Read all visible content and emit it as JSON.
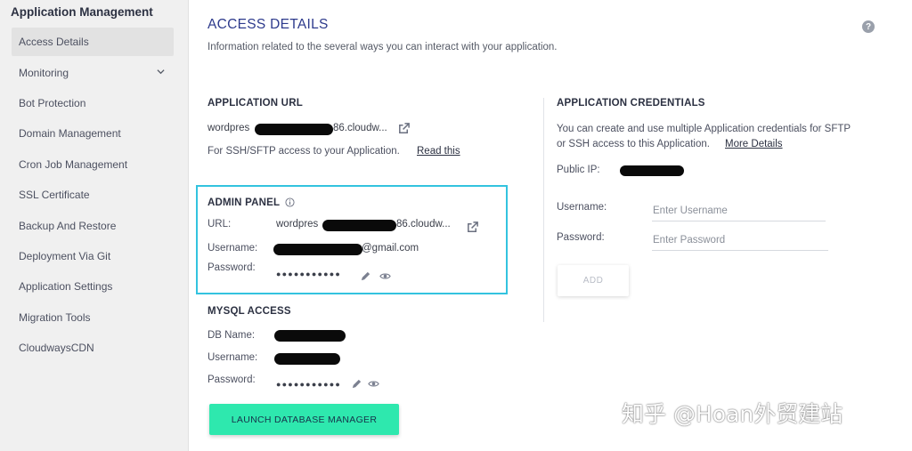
{
  "sidebar": {
    "title": "Application Management",
    "items": [
      {
        "label": "Access Details"
      },
      {
        "label": "Monitoring"
      },
      {
        "label": "Bot Protection"
      },
      {
        "label": "Domain Management"
      },
      {
        "label": "Cron Job Management"
      },
      {
        "label": "SSL Certificate"
      },
      {
        "label": "Backup And Restore"
      },
      {
        "label": "Deployment Via Git"
      },
      {
        "label": "Application Settings"
      },
      {
        "label": "Migration Tools"
      },
      {
        "label": "CloudwaysCDN"
      }
    ]
  },
  "header": {
    "title": "ACCESS DETAILS",
    "description": "Information related to the several ways you can interact with your application.",
    "help_icon": "?"
  },
  "app_url": {
    "title": "APPLICATION URL",
    "url_prefix": "wordpres",
    "url_suffix": "86.cloudw...",
    "ssh_note": "For SSH/SFTP access to your Application.",
    "read_link": "Read this"
  },
  "admin_panel": {
    "title": "ADMIN PANEL",
    "url_label": "URL:",
    "url_prefix": "wordpres",
    "url_suffix": "86.cloudw...",
    "username_label": "Username:",
    "username_suffix": "@gmail.com",
    "password_label": "Password:",
    "password_masked": "●●●●●●●●●●●"
  },
  "mysql": {
    "title": "MYSQL ACCESS",
    "db_label": "DB Name:",
    "username_label": "Username:",
    "password_label": "Password:",
    "password_masked": "●●●●●●●●●●●",
    "launch_button": "LAUNCH DATABASE MANAGER"
  },
  "credentials": {
    "title": "APPLICATION CREDENTIALS",
    "description_line1": "You can create and use multiple Application credentials for SFTP",
    "description_line2": "or SSH access to this Application.",
    "more_link": "More Details",
    "public_ip_label": "Public IP:",
    "username_label": "Username:",
    "username_placeholder": "Enter Username",
    "password_label": "Password:",
    "password_placeholder": "Enter Password",
    "add_button": "ADD"
  },
  "watermark": "知乎 @Hoan外贸建站",
  "colors": {
    "accent_title": "#2d3a8c",
    "highlight_border": "#33c3df",
    "launch_button": "#2ee8ae"
  },
  "icons": [
    "chevron-down-icon",
    "help-icon",
    "external-link-icon",
    "info-icon",
    "pencil-icon",
    "eye-icon"
  ]
}
